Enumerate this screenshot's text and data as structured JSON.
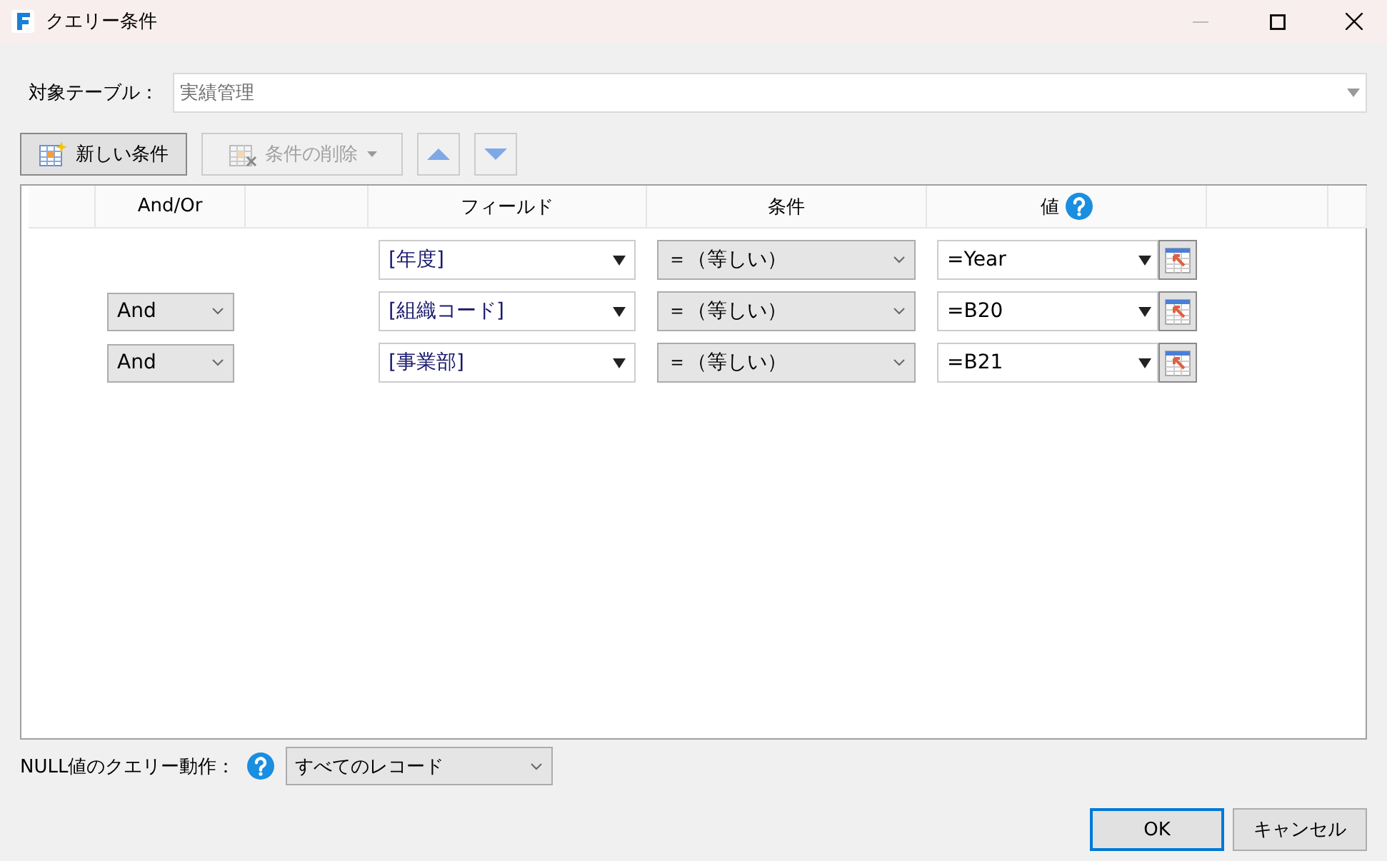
{
  "window": {
    "title": "クエリー条件"
  },
  "target_table": {
    "label": "対象テーブル：",
    "value": "実績管理"
  },
  "toolbar": [
    {
      "kind": "new",
      "label": "新しい条件",
      "disabled": false
    },
    {
      "kind": "delete",
      "label": "条件の削除",
      "disabled": true
    },
    {
      "kind": "up",
      "disabled": false
    },
    {
      "kind": "down",
      "disabled": false
    }
  ],
  "table": {
    "columns": [
      "And/Or",
      "フィールド",
      "条件",
      "値"
    ],
    "rows": [
      {
        "field": "[年度]",
        "condition": "＝（等しい）",
        "value": "=Year"
      },
      {
        "and_or": "And",
        "field": "[組織コード]",
        "condition": "＝（等しい）",
        "value": "=B20"
      },
      {
        "and_or": "And",
        "field": "[事業部]",
        "condition": "＝（等しい）",
        "value": "=B21"
      }
    ]
  },
  "null_behavior": {
    "label": "NULL値のクエリー動作：",
    "value": "すべてのレコード"
  },
  "buttons": [
    {
      "label": "OK",
      "focused": true
    },
    {
      "label": "キャンセル",
      "focused": false
    }
  ]
}
